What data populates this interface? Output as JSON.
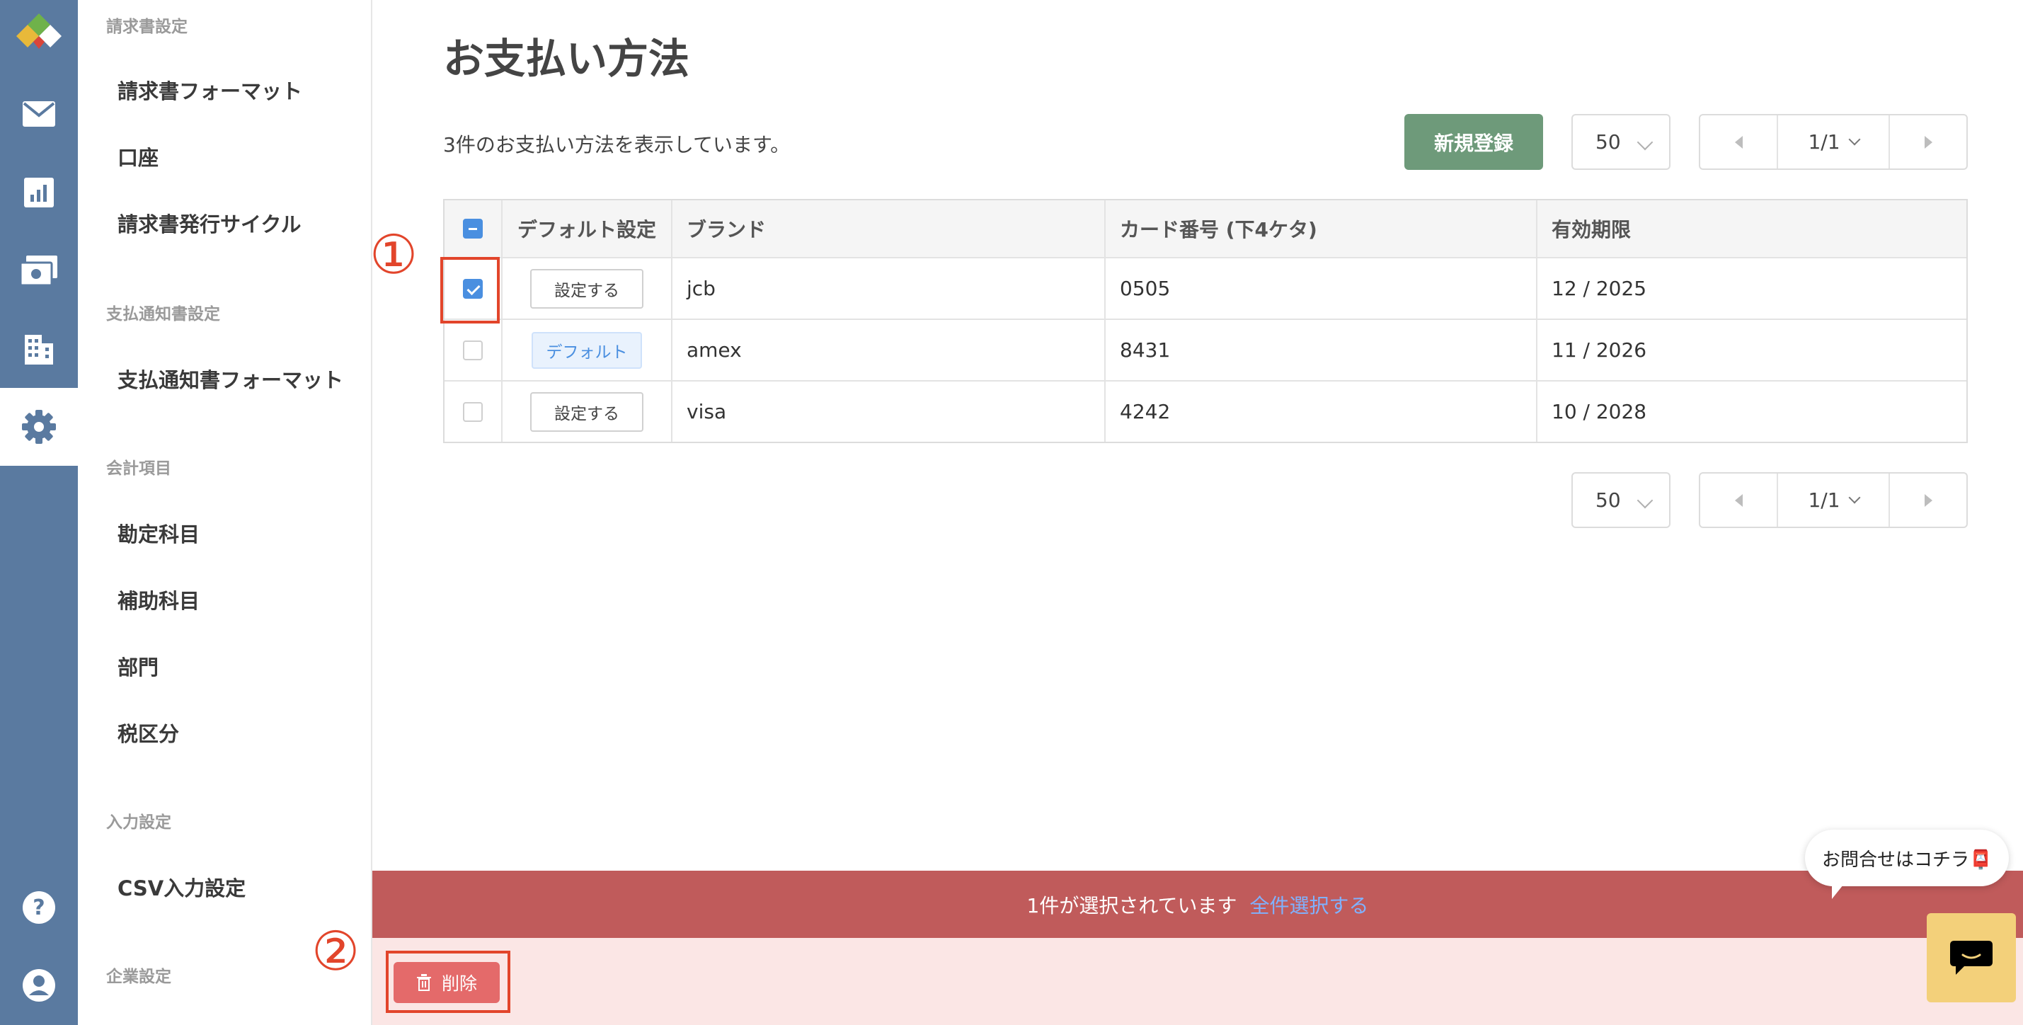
{
  "rail": {
    "icons": [
      "app-logo",
      "mail-icon",
      "chart-icon",
      "payment-icon",
      "building-icon",
      "gear-icon",
      "help-icon",
      "account-icon"
    ],
    "active": "gear-icon",
    "colors": {
      "background": "#5a7aa0",
      "active_background": "#ffffff"
    }
  },
  "sidebar": {
    "sections": [
      {
        "label": "請求書設定",
        "items": [
          "請求書フォーマット",
          "口座",
          "請求書発行サイクル"
        ]
      },
      {
        "label": "支払通知書設定",
        "items": [
          "支払通知書フォーマット"
        ]
      },
      {
        "label": "会計項目",
        "items": [
          "勘定科目",
          "補助科目",
          "部門",
          "税区分"
        ]
      },
      {
        "label": "入力設定",
        "items": [
          "CSV入力設定"
        ]
      },
      {
        "label": "企業設定",
        "items": []
      }
    ]
  },
  "main": {
    "title": "お支払い方法",
    "count_text": "3件のお支払い方法を表示しています。",
    "new_button": "新規登録",
    "per_page": "50",
    "page": "1/1"
  },
  "table": {
    "headers": [
      "デフォルト設定",
      "ブランド",
      "カード番号 (下4ケタ)",
      "有効期限"
    ],
    "rows": [
      {
        "checked": true,
        "default_action": "設定する",
        "brand": "jcb",
        "last4": "0505",
        "expiry": "12 / 2025"
      },
      {
        "checked": false,
        "default_action": "デフォルト",
        "brand": "amex",
        "last4": "8431",
        "expiry": "11 / 2026"
      },
      {
        "checked": false,
        "default_action": "設定する",
        "brand": "visa",
        "last4": "4242",
        "expiry": "10 / 2028"
      }
    ]
  },
  "selection": {
    "text": "1件が選択されています",
    "select_all": "全件選択する",
    "delete_button": "削除"
  },
  "annotations": {
    "one": "①",
    "two": "②"
  },
  "chat": {
    "bubble_text": "お問合せはコチラ📮"
  },
  "colors": {
    "accent_green": "#6e9a7a",
    "checkbox_blue": "#4a8fe0",
    "selection_bar": "#c05b5b",
    "delete_red": "#e46a6a",
    "annotation_red": "#e2452b",
    "chat_yellow": "#f3d07a"
  }
}
